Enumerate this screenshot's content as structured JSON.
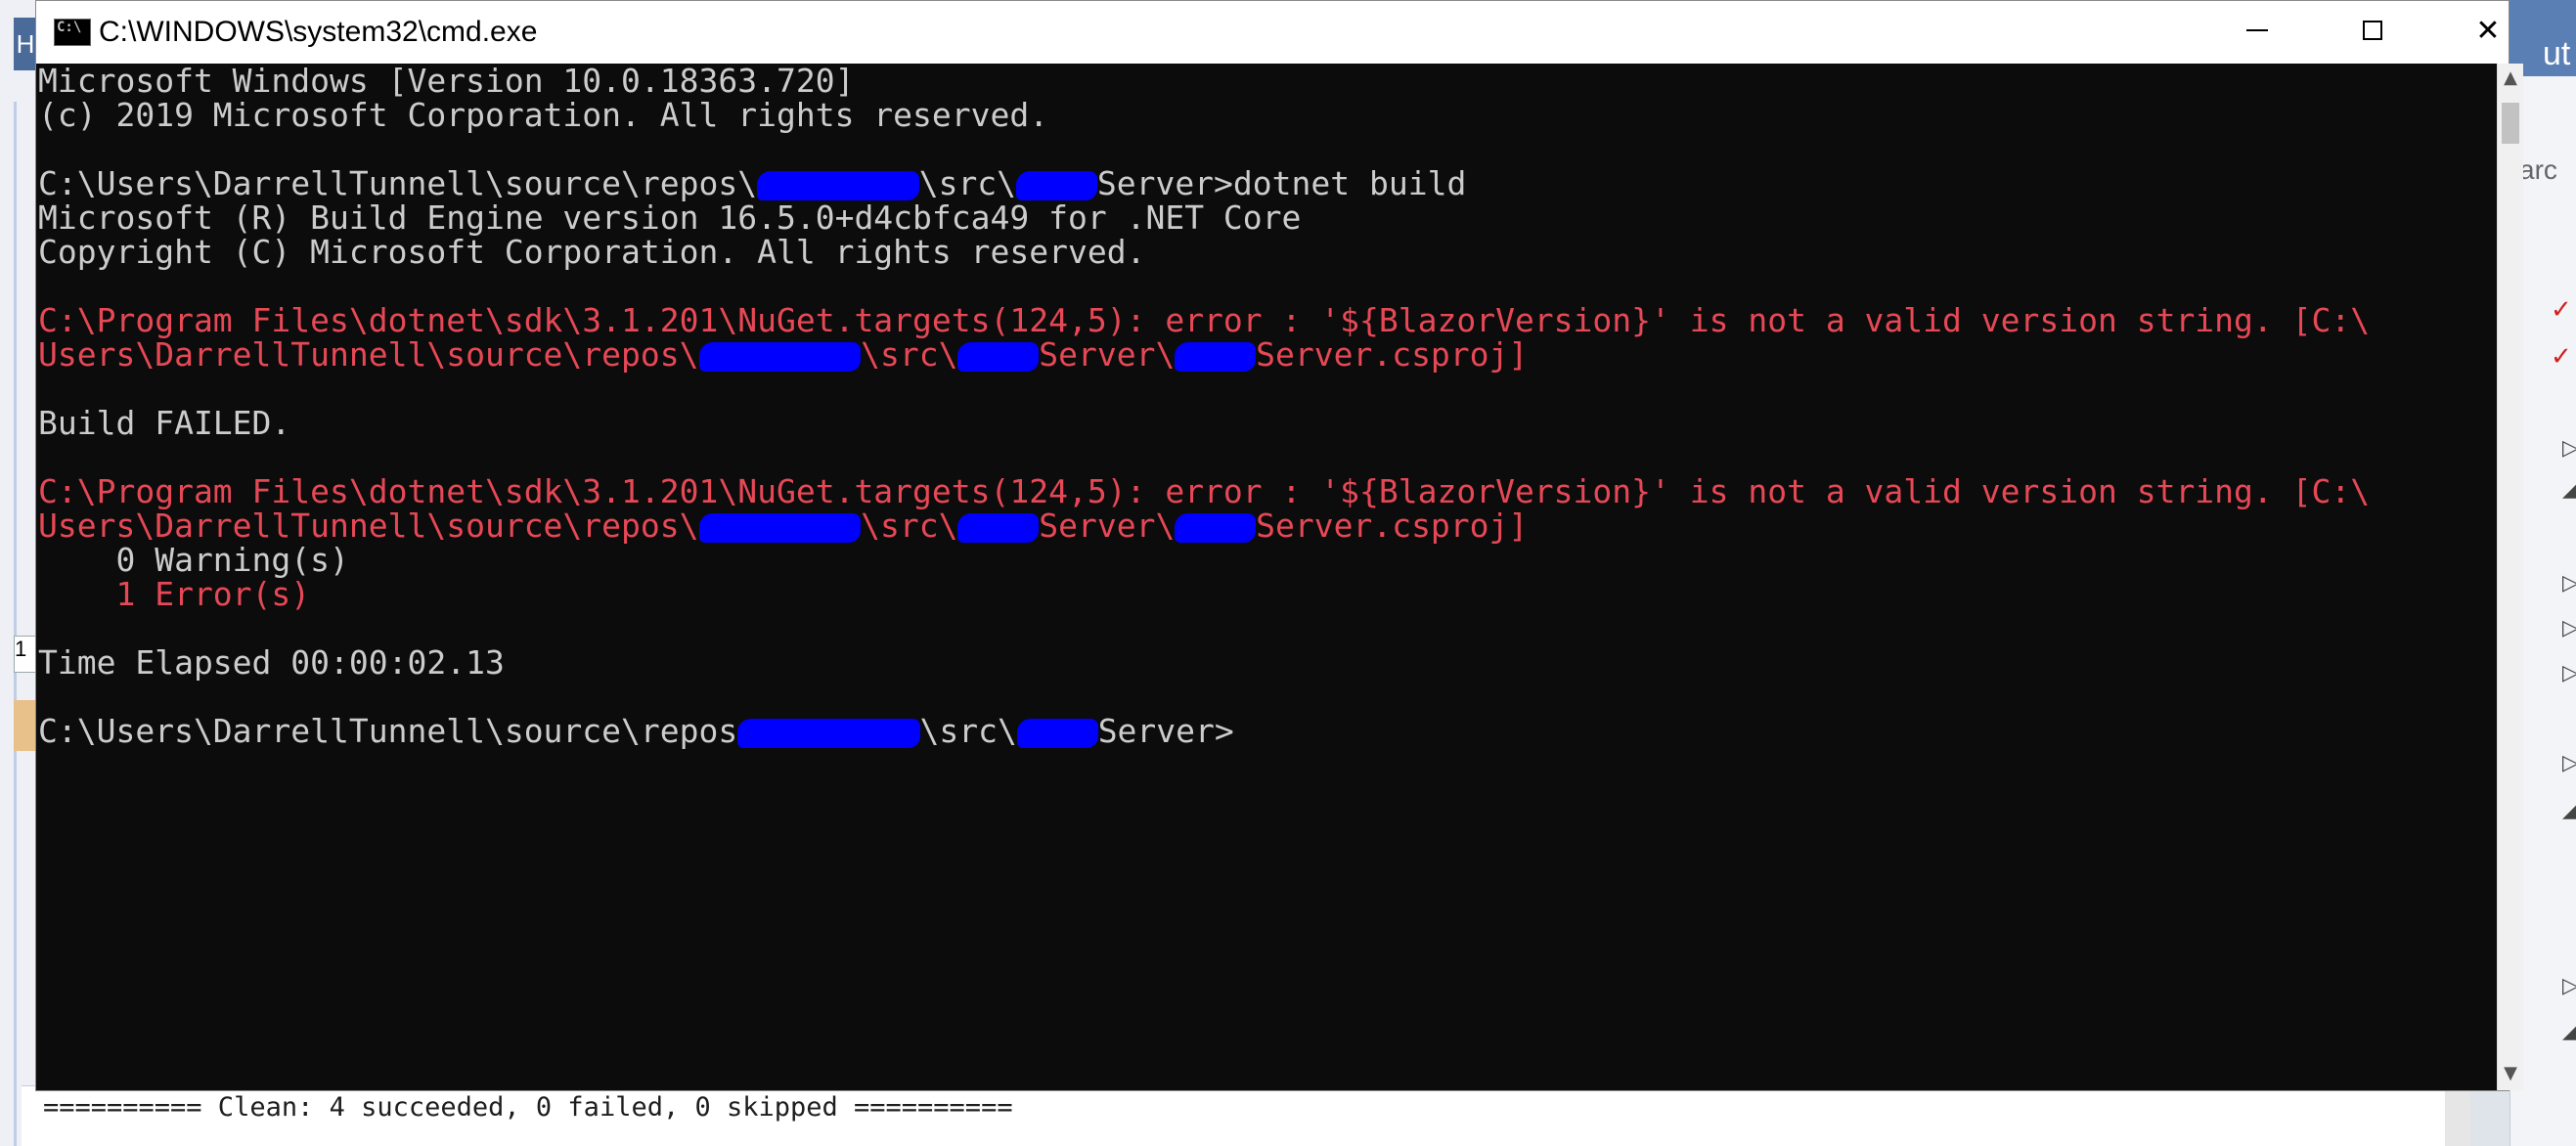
{
  "window": {
    "title": "C:\\WINDOWS\\system32\\cmd.exe",
    "icon": "cmd-icon",
    "icon_text": "C:\\"
  },
  "controls": {
    "minimize": "minimize",
    "maximize": "maximize",
    "close": "✕"
  },
  "console": {
    "lines": [
      {
        "parts": [
          {
            "t": "Microsoft Windows [Version 10.0.18363.720]"
          }
        ]
      },
      {
        "parts": [
          {
            "t": "(c) 2019 Microsoft Corporation. All rights reserved."
          }
        ]
      },
      {
        "parts": [
          {
            "t": ""
          }
        ]
      },
      {
        "parts": [
          {
            "t": "C:\\Users\\DarrellTunnell\\source\\repos\\"
          },
          {
            "redact": 8
          },
          {
            "t": "\\src\\"
          },
          {
            "redact": 4
          },
          {
            "t": "Server>dotnet build"
          }
        ]
      },
      {
        "parts": [
          {
            "t": "Microsoft (R) Build Engine version 16.5.0+d4cbfca49 for .NET Core"
          }
        ]
      },
      {
        "parts": [
          {
            "t": "Copyright (C) Microsoft Corporation. All rights reserved."
          }
        ]
      },
      {
        "parts": [
          {
            "t": ""
          }
        ]
      },
      {
        "err": true,
        "parts": [
          {
            "t": "C:\\Program Files\\dotnet\\sdk\\3.1.201\\NuGet.targets(124,5): error : '${BlazorVersion}' is not a valid version string. [C:\\"
          }
        ]
      },
      {
        "err": true,
        "parts": [
          {
            "t": "Users\\DarrellTunnell\\source\\repos\\"
          },
          {
            "redact": 8
          },
          {
            "t": "\\src\\"
          },
          {
            "redact": 4
          },
          {
            "t": "Server\\"
          },
          {
            "redact": 4
          },
          {
            "t": "Server.csproj]"
          }
        ]
      },
      {
        "parts": [
          {
            "t": ""
          }
        ]
      },
      {
        "parts": [
          {
            "t": "Build FAILED."
          }
        ]
      },
      {
        "parts": [
          {
            "t": ""
          }
        ]
      },
      {
        "err": true,
        "parts": [
          {
            "t": "C:\\Program Files\\dotnet\\sdk\\3.1.201\\NuGet.targets(124,5): error : '${BlazorVersion}' is not a valid version string. [C:\\"
          }
        ]
      },
      {
        "err": true,
        "parts": [
          {
            "t": "Users\\DarrellTunnell\\source\\repos\\"
          },
          {
            "redact": 8
          },
          {
            "t": "\\src\\"
          },
          {
            "redact": 4
          },
          {
            "t": "Server\\"
          },
          {
            "redact": 4
          },
          {
            "t": "Server.csproj]"
          }
        ]
      },
      {
        "parts": [
          {
            "t": "    0 Warning(s)"
          }
        ]
      },
      {
        "err": true,
        "parts": [
          {
            "t": "    1 Error(s)"
          }
        ]
      },
      {
        "parts": [
          {
            "t": ""
          }
        ]
      },
      {
        "parts": [
          {
            "t": "Time Elapsed 00:00:02.13"
          }
        ]
      },
      {
        "parts": [
          {
            "t": ""
          }
        ]
      },
      {
        "parts": [
          {
            "t": "C:\\Users\\DarrellTunnell\\source\\repos"
          },
          {
            "redact": 9
          },
          {
            "t": "\\src\\"
          },
          {
            "redact": 4
          },
          {
            "t": "Server>"
          }
        ]
      }
    ]
  },
  "colors": {
    "console_bg": "#0c0c0c",
    "console_text": "#cccccc",
    "error_text": "#e74856",
    "redaction": "#0000ff"
  },
  "background": {
    "output_text": "========== Clean: 4 succeeded, 0 failed, 0 skipped ==========",
    "left_tab_char": "H",
    "left_line_char": "1",
    "right_top_text": "ut",
    "right_search_text": "arc"
  }
}
